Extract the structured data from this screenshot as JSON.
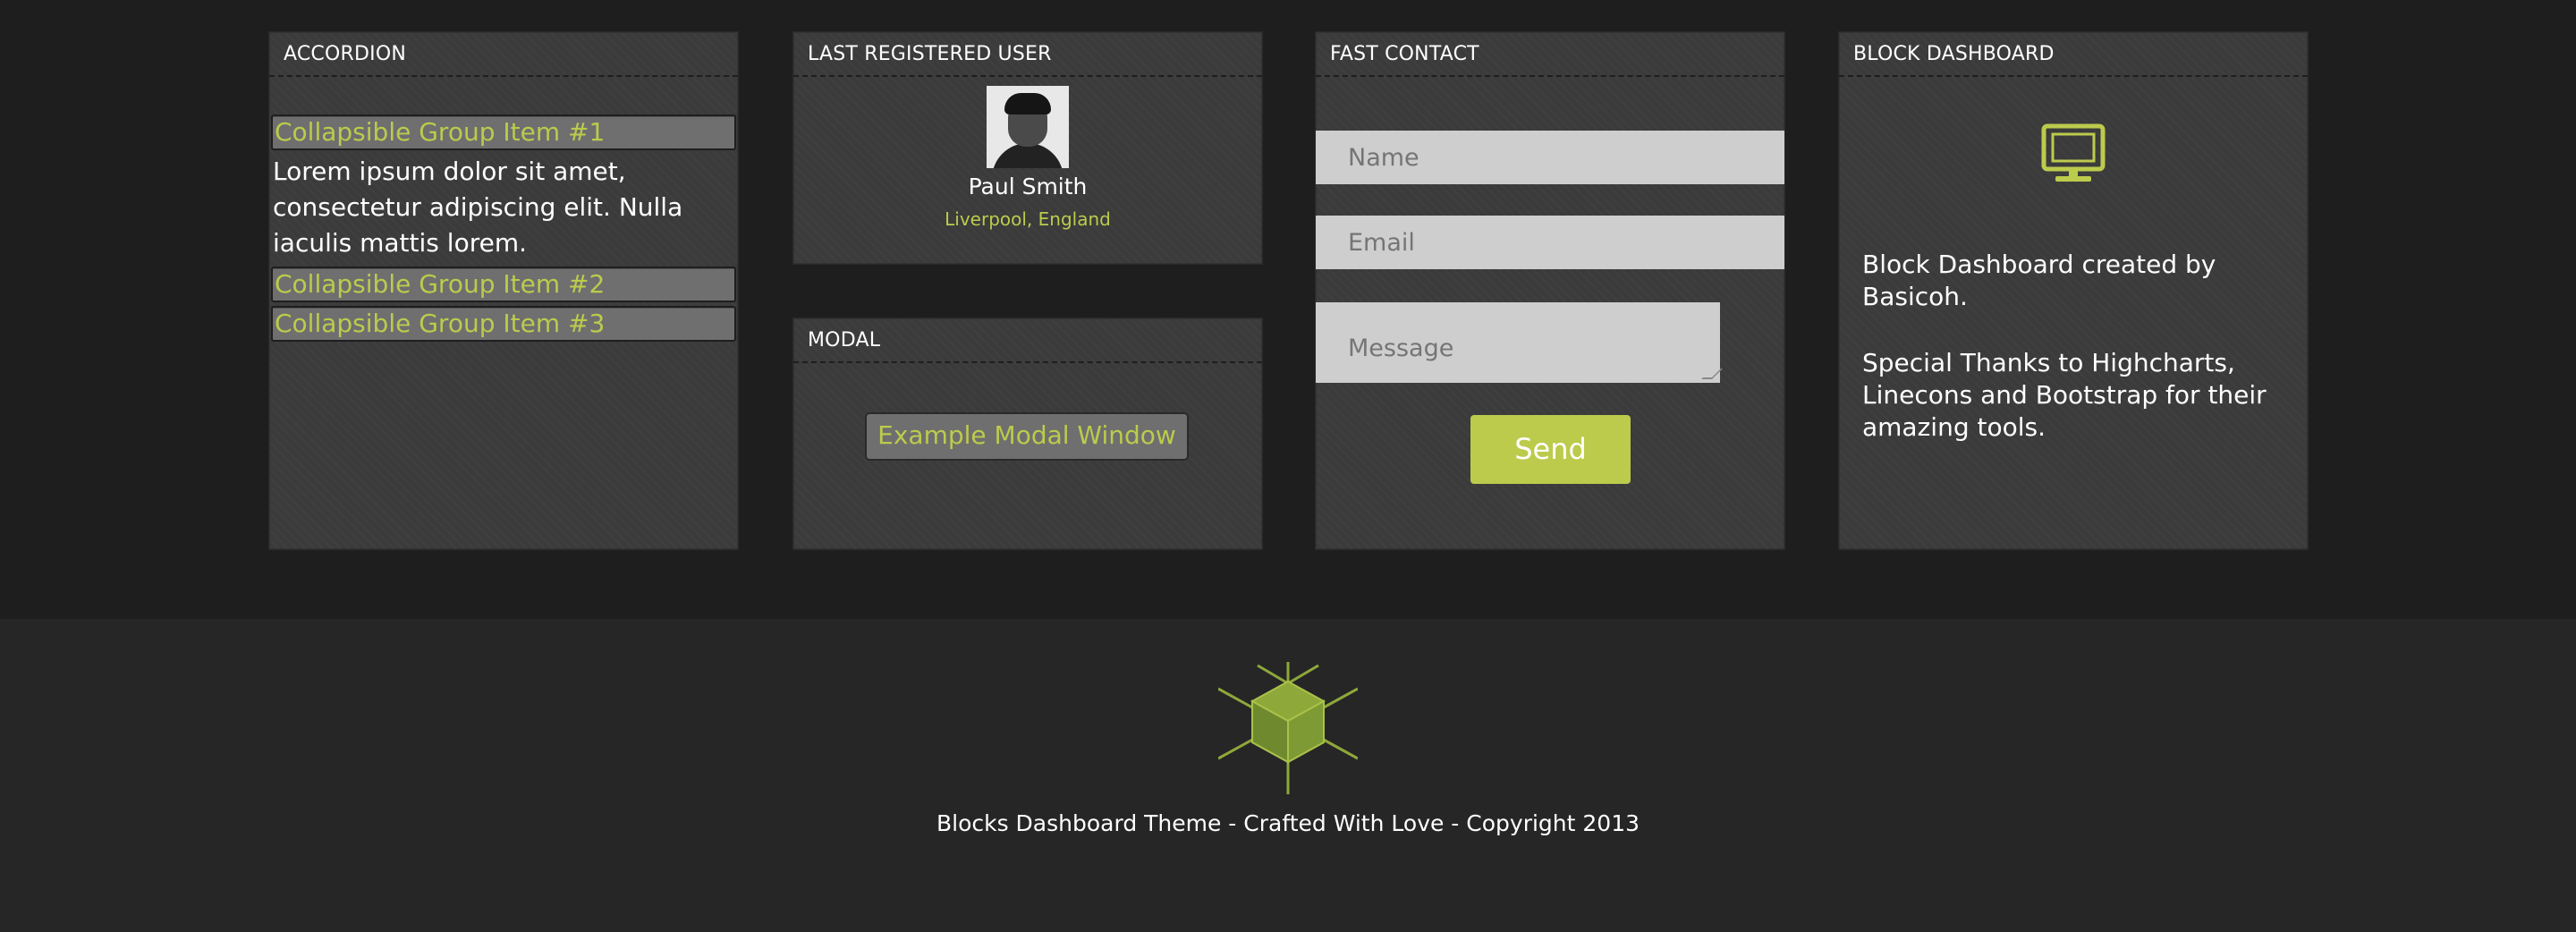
{
  "colors": {
    "accent": "#bccb4c",
    "panel": "#3b3b3b",
    "background": "#1e1e1e",
    "footer": "#262626"
  },
  "accordion": {
    "title": "ACCORDION",
    "items": [
      {
        "label": "Collapsible Group Item #1",
        "body": "Lorem ipsum dolor sit amet, consectetur adipiscing elit. Nulla iaculis mattis lorem."
      },
      {
        "label": "Collapsible Group Item #2"
      },
      {
        "label": "Collapsible Group Item #3"
      }
    ]
  },
  "last_user": {
    "title": "LAST REGISTERED USER",
    "name": "Paul Smith",
    "location": "Liverpool, England"
  },
  "modal": {
    "title": "MODAL",
    "button_label": "Example Modal Window"
  },
  "contact": {
    "title": "FAST CONTACT",
    "name_placeholder": "Name",
    "email_placeholder": "Email",
    "message_placeholder": "Message",
    "send_label": "Send"
  },
  "block_dashboard": {
    "title": "BLOCK DASHBOARD",
    "icon": "monitor-icon",
    "line1": "Block Dashboard created by Basicoh.",
    "line2": "Special Thanks to Highcharts, Linecons and Bootstrap for their amazing tools."
  },
  "footer": {
    "logo_icon": "cube-logo",
    "text": "Blocks Dashboard Theme - Crafted With Love - Copyright 2013"
  }
}
